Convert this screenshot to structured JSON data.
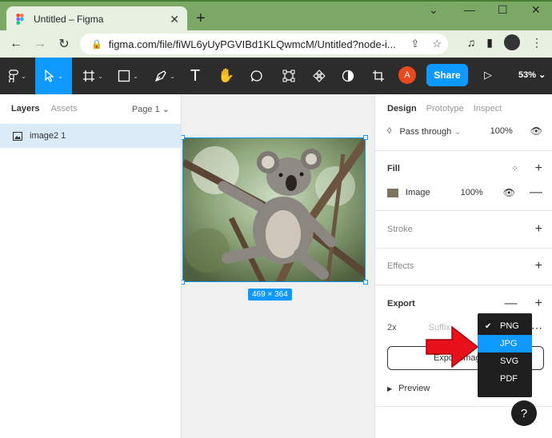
{
  "browser": {
    "tab_title": "Untitled – Figma",
    "url": "figma.com/file/fiWL6yUyPGVIBd1KLQwmcM/Untitled?node-i...",
    "new_tab": "+",
    "tab_close": "✕"
  },
  "toolbar": {
    "avatar_letter": "A",
    "share_label": "Share",
    "zoom": "53%"
  },
  "layers_panel": {
    "tab_layers": "Layers",
    "tab_assets": "Assets",
    "page_label": "Page 1",
    "layers": [
      {
        "name": "image2 1"
      }
    ]
  },
  "canvas": {
    "dimensions_label": "469 × 364"
  },
  "design_panel": {
    "tabs": [
      "Design",
      "Prototype",
      "Inspect"
    ],
    "layer_blend": "Pass through",
    "layer_opacity": "100%",
    "fill": {
      "title": "Fill",
      "type": "Image",
      "opacity": "100%"
    },
    "stroke_title": "Stroke",
    "effects_title": "Effects",
    "export": {
      "title": "Export",
      "scale": "2x",
      "suffix_placeholder": "Suffix",
      "button_label": "Export image2 1",
      "preview_label": "Preview"
    }
  },
  "format_dropdown": {
    "options": [
      "PNG",
      "JPG",
      "SVG",
      "PDF"
    ],
    "checked": "PNG",
    "highlighted": "JPG"
  },
  "help_label": "?",
  "colors": {
    "accent": "#0d99ff",
    "toolbar_bg": "#2c2c2c",
    "browser_frame": "#7ca866",
    "arrow": "#e8101a"
  }
}
